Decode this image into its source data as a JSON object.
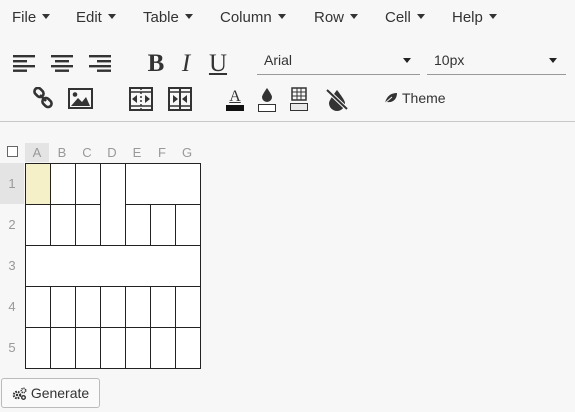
{
  "menu": {
    "items": [
      {
        "label": "File"
      },
      {
        "label": "Edit"
      },
      {
        "label": "Table"
      },
      {
        "label": "Column"
      },
      {
        "label": "Row"
      },
      {
        "label": "Cell"
      },
      {
        "label": "Help"
      }
    ]
  },
  "toolbar": {
    "bold": "B",
    "italic": "I",
    "underline": "U",
    "font_family": {
      "value": "Arial"
    },
    "font_size": {
      "value": "10px"
    },
    "text_color_glyph": "A",
    "theme_label": "Theme",
    "icons": [
      "align-left-icon",
      "align-center-icon",
      "align-right-icon",
      "link-icon",
      "image-icon",
      "merge-cells-icon",
      "split-cells-icon",
      "text-color-icon",
      "fill-color-icon",
      "border-icon",
      "clear-format-icon",
      "leaf-icon"
    ]
  },
  "sheet": {
    "columns": [
      "A",
      "B",
      "C",
      "D",
      "E",
      "F",
      "G"
    ],
    "rows": [
      "1",
      "2",
      "3",
      "4",
      "5"
    ],
    "selected_column": "A",
    "selected_row": "1",
    "active_cell": "A1"
  },
  "generate_button": {
    "label": "Generate",
    "icon": "gears-icon"
  }
}
